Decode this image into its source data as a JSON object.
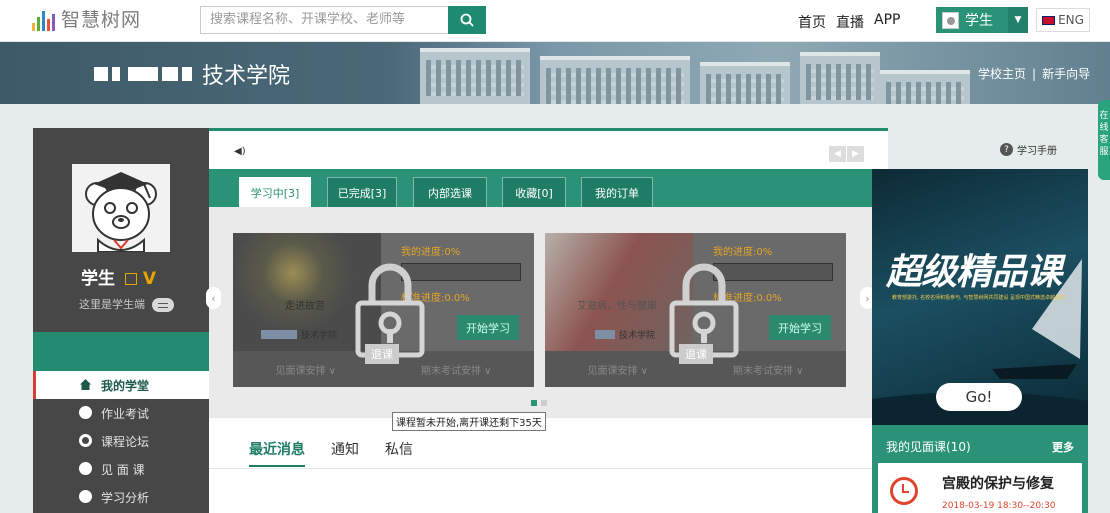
{
  "header": {
    "logo_text": "智慧树网",
    "search_placeholder": "搜索课程名称、开课学校、老师等",
    "nav": [
      "首页",
      "直播",
      "APP"
    ],
    "role_label": "学生",
    "lang_label": "ENG"
  },
  "banner": {
    "school_name": "技术学院",
    "links": [
      "学校主页",
      "新手向导"
    ]
  },
  "side_tab": "在线客服",
  "profile": {
    "name": "学生",
    "badge": "V",
    "subtitle": "这里是学生端"
  },
  "menu": [
    {
      "label": "我的学堂",
      "icon": "home-icon",
      "active": true
    },
    {
      "label": "作业考试",
      "icon": "pen-icon"
    },
    {
      "label": "课程论坛",
      "icon": "chat-icon"
    },
    {
      "label": "见 面 课",
      "icon": "meeting-icon"
    },
    {
      "label": "学习分析",
      "icon": "chart-icon"
    }
  ],
  "manual_label": "学习手册",
  "tabs": [
    "学习中[3]",
    "已完成[3]",
    "内部选课",
    "收藏[0]",
    "我的订单"
  ],
  "courses": [
    {
      "title": "走进故宫",
      "school": "技术学院",
      "my_progress": "我的进度:0%",
      "standard_progress": "标准进度:0.0%",
      "start_label": "开始学习",
      "meet_label": "见面课安排",
      "exam_label": "期末考试安排",
      "quit_label": "退课"
    },
    {
      "title": "艾滋病、性与健康",
      "school": "技术学院",
      "my_progress": "我的进度:0%",
      "standard_progress": "标准进度:0.0%",
      "start_label": "开始学习",
      "meet_label": "见面课安排",
      "exam_label": "期末考试安排",
      "quit_label": "退课"
    }
  ],
  "tooltip": "课程暂未开始,离开课还剩下35天",
  "messages": {
    "tabs": [
      "最近消息",
      "通知",
      "私信"
    ]
  },
  "ad": {
    "title": "超级精品课",
    "subtitle": "教育部委托, 名校名师积极参与, 与智慧树网共同建设 呈现中国式精选卓越品质",
    "go_label": "Go!"
  },
  "meet_course": {
    "header": "我的见面课(10)",
    "more": "更多",
    "title": "宫殿的保护与修复",
    "time": "2018-03-19 18:30--20:30"
  },
  "colors": {
    "accent": "#2a9276",
    "sidebar": "#474747",
    "badge": "#e8a500",
    "alert": "#e0442e"
  }
}
